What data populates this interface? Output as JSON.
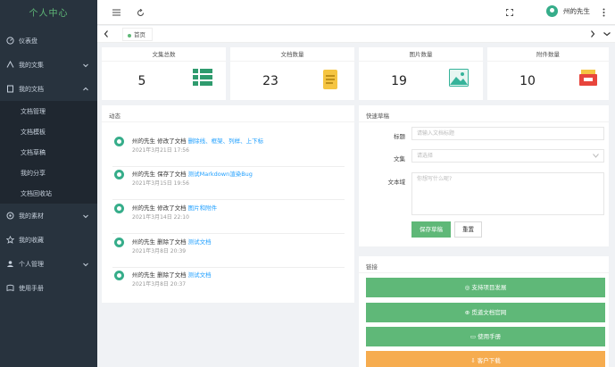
{
  "sidebar": {
    "brand": "个人中心",
    "items": [
      {
        "label": "仪表盘",
        "icon": "dashboard-icon"
      },
      {
        "label": "我的文集",
        "icon": "collection-icon"
      },
      {
        "label": "我的文档",
        "icon": "document-icon"
      },
      {
        "label": "我的素材",
        "icon": "material-icon"
      },
      {
        "label": "我的收藏",
        "icon": "star-icon"
      },
      {
        "label": "个人管理",
        "icon": "user-manage-icon"
      },
      {
        "label": "使用手册",
        "icon": "manual-icon"
      }
    ],
    "sub_items": [
      "文档管理",
      "文档模板",
      "文档草稿",
      "我的分享",
      "文档回收站"
    ]
  },
  "header": {
    "user_name": "州的先生"
  },
  "tabs": {
    "home": "首页"
  },
  "stats": [
    {
      "title": "文集总数",
      "value": "5",
      "icon": "list-icon",
      "color": "#2f9b6e"
    },
    {
      "title": "文档数量",
      "value": "23",
      "icon": "notepad-icon",
      "color": "#f5c542"
    },
    {
      "title": "图片数量",
      "value": "19",
      "icon": "image-icon",
      "color": "#36b39a"
    },
    {
      "title": "附件数量",
      "value": "10",
      "icon": "attachment-box-icon",
      "color": "#e8453c"
    }
  ],
  "activity": {
    "title": "动态",
    "entries": [
      {
        "text": "州的先生 修改了文档",
        "link": "删除线、框架、列样、上下标",
        "time": "2021年3月21日 17:56"
      },
      {
        "text": "州的先生 保存了文档",
        "link": "测试Markdown渲染Bug",
        "time": "2021年3月15日 19:56"
      },
      {
        "text": "州的先生 修改了文档",
        "link": "图片和附件",
        "time": "2021年3月14日 22:10"
      },
      {
        "text": "州的先生 删除了文档",
        "link": "测试文档",
        "time": "2021年3月8日 20:39"
      },
      {
        "text": "州的先生 删除了文档",
        "link": "测试文档",
        "time": "2021年3月8日 20:37"
      }
    ]
  },
  "quick_draft": {
    "title": "快速草稿",
    "title_label": "标题",
    "title_placeholder": "请输入文档标题",
    "collection_label": "文集",
    "collection_placeholder": "请选择",
    "text_label": "文本域",
    "text_placeholder": "你想写什么呢?",
    "save_label": "保存草稿",
    "reset_label": "重置"
  },
  "links": {
    "title": "链接",
    "items": [
      {
        "label": "◎ 支持项目发展",
        "color": "#5fb878"
      },
      {
        "label": "⊕ 觅道文档官网",
        "color": "#5fb878"
      },
      {
        "label": "▭ 使用手册",
        "color": "#5fb878"
      },
      {
        "label": "⇩ 客户下载",
        "color": "#f6ac4f"
      }
    ]
  }
}
